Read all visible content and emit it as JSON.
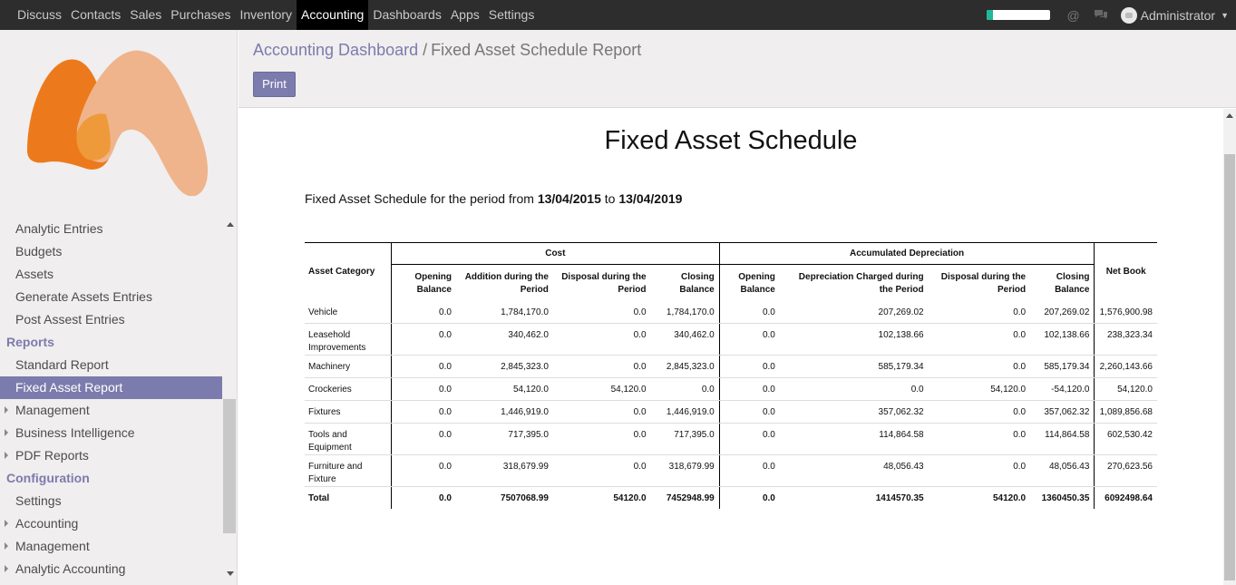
{
  "topbar": {
    "menu": [
      "Discuss",
      "Contacts",
      "Sales",
      "Purchases",
      "Inventory",
      "Accounting",
      "Dashboards",
      "Apps",
      "Settings"
    ],
    "active_index": 5,
    "progress_fraction": 0.1,
    "icons": [
      "at-icon",
      "chat-icon"
    ],
    "user": "Administrator"
  },
  "sidebar": {
    "items": [
      {
        "label": "Analytic Entries",
        "kind": "item"
      },
      {
        "label": "Budgets",
        "kind": "item"
      },
      {
        "label": "Assets",
        "kind": "item"
      },
      {
        "label": "Generate Assets Entries",
        "kind": "item"
      },
      {
        "label": "Post Assest Entries",
        "kind": "item"
      },
      {
        "label": "Reports",
        "kind": "section"
      },
      {
        "label": "Standard Report",
        "kind": "item"
      },
      {
        "label": "Fixed Asset Report",
        "kind": "item",
        "active": true
      },
      {
        "label": "Management",
        "kind": "arrow"
      },
      {
        "label": "Business Intelligence",
        "kind": "arrow"
      },
      {
        "label": "PDF Reports",
        "kind": "arrow"
      },
      {
        "label": "Configuration",
        "kind": "section"
      },
      {
        "label": "Settings",
        "kind": "item"
      },
      {
        "label": "Accounting",
        "kind": "arrow"
      },
      {
        "label": "Management",
        "kind": "arrow"
      },
      {
        "label": "Analytic Accounting",
        "kind": "arrow"
      }
    ]
  },
  "control": {
    "breadcrumb_link": "Accounting Dashboard",
    "breadcrumb_sep": "/",
    "breadcrumb_current": "Fixed Asset Schedule Report",
    "print_label": "Print"
  },
  "report": {
    "title": "Fixed Asset Schedule",
    "period_prefix": "Fixed Asset Schedule for the period from",
    "date_from": "13/04/2015",
    "period_to": "to",
    "date_to": "13/04/2019",
    "headers": {
      "asset_category": "Asset Category",
      "cost": "Cost",
      "accumulated_depreciation": "Accumulated Depreciation",
      "net_book": "Net Book",
      "cost_cols": [
        "Opening Balance",
        "Addition during the Period",
        "Disposal during the Period",
        "Closing Balance"
      ],
      "dep_cols": [
        "Opening Balance",
        "Depreciation Charged during the Period",
        "Disposal during the Period",
        "Closing Balance"
      ]
    },
    "rows": [
      {
        "cat": "Vehicle",
        "vals": [
          "0.0",
          "1,784,170.0",
          "0.0",
          "1,784,170.0",
          "0.0",
          "207,269.02",
          "0.0",
          "207,269.02",
          "1,576,900.98"
        ]
      },
      {
        "cat": "Leasehold Improvements",
        "vals": [
          "0.0",
          "340,462.0",
          "0.0",
          "340,462.0",
          "0.0",
          "102,138.66",
          "0.0",
          "102,138.66",
          "238,323.34"
        ]
      },
      {
        "cat": "Machinery",
        "vals": [
          "0.0",
          "2,845,323.0",
          "0.0",
          "2,845,323.0",
          "0.0",
          "585,179.34",
          "0.0",
          "585,179.34",
          "2,260,143.66"
        ]
      },
      {
        "cat": "Crockeries",
        "vals": [
          "0.0",
          "54,120.0",
          "54,120.0",
          "0.0",
          "0.0",
          "0.0",
          "54,120.0",
          "-54,120.0",
          "54,120.0"
        ]
      },
      {
        "cat": "Fixtures",
        "vals": [
          "0.0",
          "1,446,919.0",
          "0.0",
          "1,446,919.0",
          "0.0",
          "357,062.32",
          "0.0",
          "357,062.32",
          "1,089,856.68"
        ]
      },
      {
        "cat": "Tools and Equipment",
        "vals": [
          "0.0",
          "717,395.0",
          "0.0",
          "717,395.0",
          "0.0",
          "114,864.58",
          "0.0",
          "114,864.58",
          "602,530.42"
        ]
      },
      {
        "cat": "Furniture and Fixture",
        "vals": [
          "0.0",
          "318,679.99",
          "0.0",
          "318,679.99",
          "0.0",
          "48,056.43",
          "0.0",
          "48,056.43",
          "270,623.56"
        ]
      }
    ],
    "total": {
      "cat": "Total",
      "vals": [
        "0.0",
        "7507068.99",
        "54120.0",
        "7452948.99",
        "0.0",
        "1414570.35",
        "54120.0",
        "1360450.35",
        "6092498.64"
      ]
    }
  }
}
